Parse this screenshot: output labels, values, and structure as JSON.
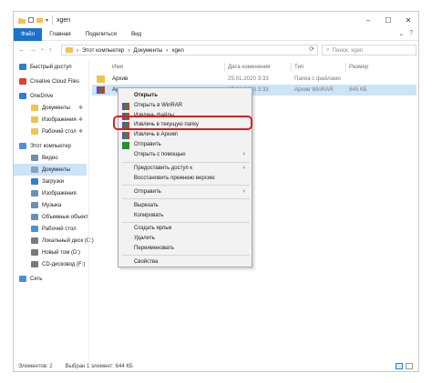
{
  "window": {
    "title": "xgen"
  },
  "ribbon": {
    "tabs": [
      "Файл",
      "Главная",
      "Поделиться",
      "Вид"
    ]
  },
  "address": {
    "segments": [
      "Этот компьютер",
      "Документы",
      "xgen"
    ],
    "search_placeholder": "Поиск: xgen"
  },
  "sidebar": {
    "items": [
      {
        "label": "Быстрый доступ",
        "icon": "star-icon",
        "color": "#2f7fd1",
        "indent": 0,
        "pinned": false,
        "selected": false
      },
      {
        "label": "Creative Cloud Files",
        "icon": "cloud-icon",
        "color": "#e33d2f",
        "indent": 0,
        "pinned": false,
        "selected": false
      },
      {
        "label": "OneDrive",
        "icon": "cloud-icon",
        "color": "#2f7fd1",
        "indent": 0,
        "pinned": false,
        "selected": false
      },
      {
        "label": "Документы",
        "icon": "folder-icon",
        "color": "#f2c250",
        "indent": 1,
        "pinned": true,
        "selected": false
      },
      {
        "label": "Изображения",
        "icon": "folder-icon",
        "color": "#f2c250",
        "indent": 1,
        "pinned": true,
        "selected": false
      },
      {
        "label": "Рабочий стол",
        "icon": "folder-icon",
        "color": "#f2c250",
        "indent": 1,
        "pinned": true,
        "selected": false
      },
      {
        "label": "Этот компьютер",
        "icon": "computer-icon",
        "color": "#4a90d9",
        "indent": 0,
        "pinned": false,
        "selected": false
      },
      {
        "label": "Видео",
        "icon": "video-icon",
        "color": "#6a8fb3",
        "indent": 1,
        "pinned": false,
        "selected": false
      },
      {
        "label": "Документы",
        "icon": "documents-icon",
        "color": "#8aa3bd",
        "indent": 1,
        "pinned": false,
        "selected": true
      },
      {
        "label": "Загрузки",
        "icon": "download-icon",
        "color": "#2f7fd1",
        "indent": 1,
        "pinned": false,
        "selected": false
      },
      {
        "label": "Изображения",
        "icon": "pictures-icon",
        "color": "#6a8fb3",
        "indent": 1,
        "pinned": false,
        "selected": false
      },
      {
        "label": "Музыка",
        "icon": "music-icon",
        "color": "#6a8fb3",
        "indent": 1,
        "pinned": false,
        "selected": false
      },
      {
        "label": "Объемные объект",
        "icon": "3d-objects-icon",
        "color": "#6a8fb3",
        "indent": 1,
        "pinned": false,
        "selected": false
      },
      {
        "label": "Рабочий стол",
        "icon": "desktop-icon",
        "color": "#4a90d9",
        "indent": 1,
        "pinned": false,
        "selected": false
      },
      {
        "label": "Локальный диск (C:)",
        "icon": "drive-icon",
        "color": "#7a7a7a",
        "indent": 1,
        "pinned": false,
        "selected": false
      },
      {
        "label": "Новый том (D:)",
        "icon": "drive-icon",
        "color": "#7a7a7a",
        "indent": 1,
        "pinned": false,
        "selected": false
      },
      {
        "label": "CD-дисковод (F:)",
        "icon": "cd-drive-icon",
        "color": "#7a7a7a",
        "indent": 1,
        "pinned": false,
        "selected": false
      },
      {
        "label": "Сеть",
        "icon": "network-icon",
        "color": "#4a90d9",
        "indent": 0,
        "pinned": false,
        "selected": false
      }
    ]
  },
  "columns": {
    "name": "Имя",
    "date": "Дата изменения",
    "type": "Тип",
    "size": "Размер"
  },
  "files": [
    {
      "name": "Архив",
      "date": "25.01.2020 3:33",
      "type": "Папка с файлами",
      "size": "",
      "icon": "folder-icon",
      "selected": false
    },
    {
      "name": "Архив",
      "date": "25.01.2020 3:33",
      "type": "Архив WinRAR",
      "size": "645 КБ",
      "icon": "winrar-icon",
      "selected": true
    }
  ],
  "context_menu": {
    "items": [
      {
        "label": "Открыть",
        "bold": true,
        "icon": "",
        "arrow": false
      },
      {
        "label": "Открыть в WinRAR",
        "bold": false,
        "icon": "winrar-icon",
        "arrow": false
      },
      {
        "label": "Извлечь файлы...",
        "bold": false,
        "icon": "winrar-icon",
        "arrow": false
      },
      {
        "label": "Извлечь в текущую папку",
        "bold": false,
        "icon": "winrar-icon",
        "arrow": false
      },
      {
        "label": "Извлечь в Архив\\",
        "bold": false,
        "icon": "winrar-icon",
        "arrow": false
      },
      {
        "label": "Отправить",
        "bold": false,
        "icon": "share-icon",
        "arrow": false
      },
      {
        "label": "Открыть с помощью",
        "bold": false,
        "icon": "",
        "arrow": true
      },
      {
        "label": "Предоставить доступ к",
        "bold": false,
        "icon": "",
        "arrow": true
      },
      {
        "label": "Восстановить прежнюю версию",
        "bold": false,
        "icon": "",
        "arrow": false
      },
      {
        "label": "Отправить",
        "bold": false,
        "icon": "",
        "arrow": true
      },
      {
        "label": "Вырезать",
        "bold": false,
        "icon": "",
        "arrow": false
      },
      {
        "label": "Копировать",
        "bold": false,
        "icon": "",
        "arrow": false
      },
      {
        "label": "Создать ярлык",
        "bold": false,
        "icon": "",
        "arrow": false
      },
      {
        "label": "Удалить",
        "bold": false,
        "icon": "",
        "arrow": false
      },
      {
        "label": "Переименовать",
        "bold": false,
        "icon": "",
        "arrow": false
      },
      {
        "label": "Свойства",
        "bold": false,
        "icon": "",
        "arrow": false
      }
    ],
    "highlighted_label": "Извлечь в текущую папку"
  },
  "status": {
    "count": "Элементов: 2",
    "selection": "Выбран 1 элемент: 644 КБ"
  },
  "colors": {
    "accent": "#1a73c9",
    "selection": "#cce4f7",
    "highlight_frame": "#d81f1f",
    "folder": "#f2c250"
  }
}
